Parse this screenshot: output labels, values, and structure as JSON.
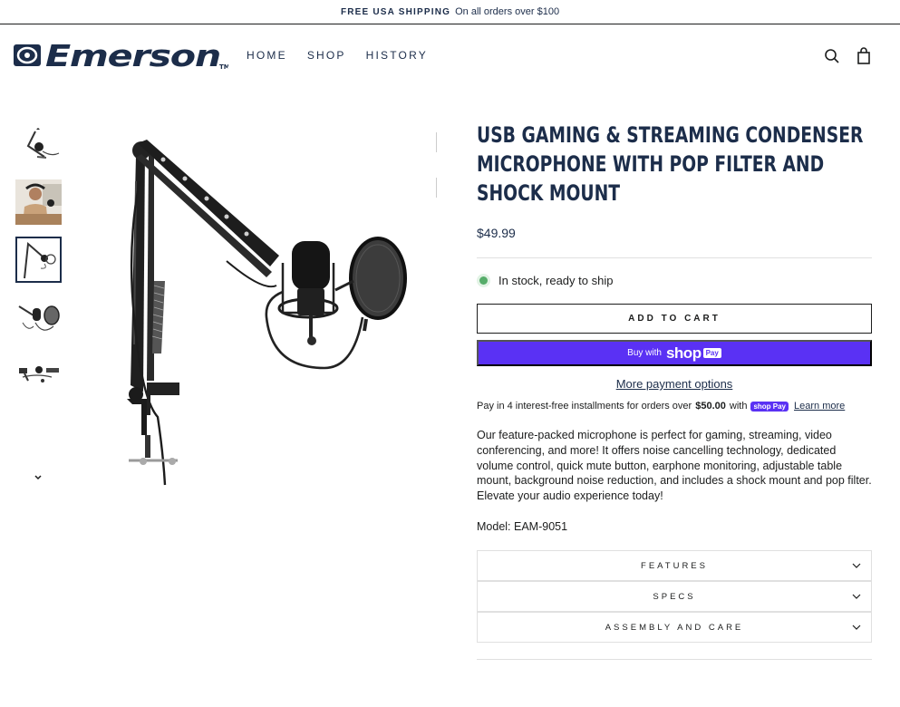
{
  "announcement": {
    "bold": "FREE USA SHIPPING",
    "text": "On all orders over $100"
  },
  "brand": {
    "name": "Emerson",
    "color": "#1c2d4a"
  },
  "nav": {
    "items": [
      "HOME",
      "SHOP",
      "HISTORY"
    ]
  },
  "header_icons": [
    "search-icon",
    "cart-icon"
  ],
  "gallery": {
    "up_icon": "chevron-up-icon",
    "down_icon": "chevron-down-icon",
    "thumbnails": [
      "mic-arm-side",
      "person-streaming",
      "mic-boom-arm",
      "mic-pop-filter",
      "accessories-kit"
    ],
    "active_index": 2
  },
  "product": {
    "title": "USB GAMING & STREAMING CONDENSER MICROPHONE WITH POP FILTER AND SHOCK MOUNT",
    "price": "$49.99",
    "stock": "In stock, ready to ship",
    "add_to_cart": "ADD TO CART",
    "buy_with": "Buy with",
    "shop_word": "shop",
    "pay_word": "Pay",
    "more_payment": "More payment options",
    "install_pre": "Pay in 4 interest-free installments for orders over",
    "install_amount": "$50.00",
    "install_with": "with",
    "install_badge": "shop Pay",
    "learn_more": "Learn more",
    "description": "Our feature-packed microphone is perfect for gaming, streaming, video conferencing, and more! It offers noise cancelling technology, dedicated volume control, quick mute button, earphone monitoring, adjustable table mount, background noise reduction, and includes a shock mount and pop filter. Elevate your audio experience today!",
    "model": "Model: EAM-9051",
    "accordions": [
      "FEATURES",
      "SPECS",
      "ASSEMBLY AND CARE"
    ]
  },
  "colors": {
    "accent": "#5a31f4",
    "navy": "#1c2d4a",
    "stock_green": "#56ad6a"
  }
}
